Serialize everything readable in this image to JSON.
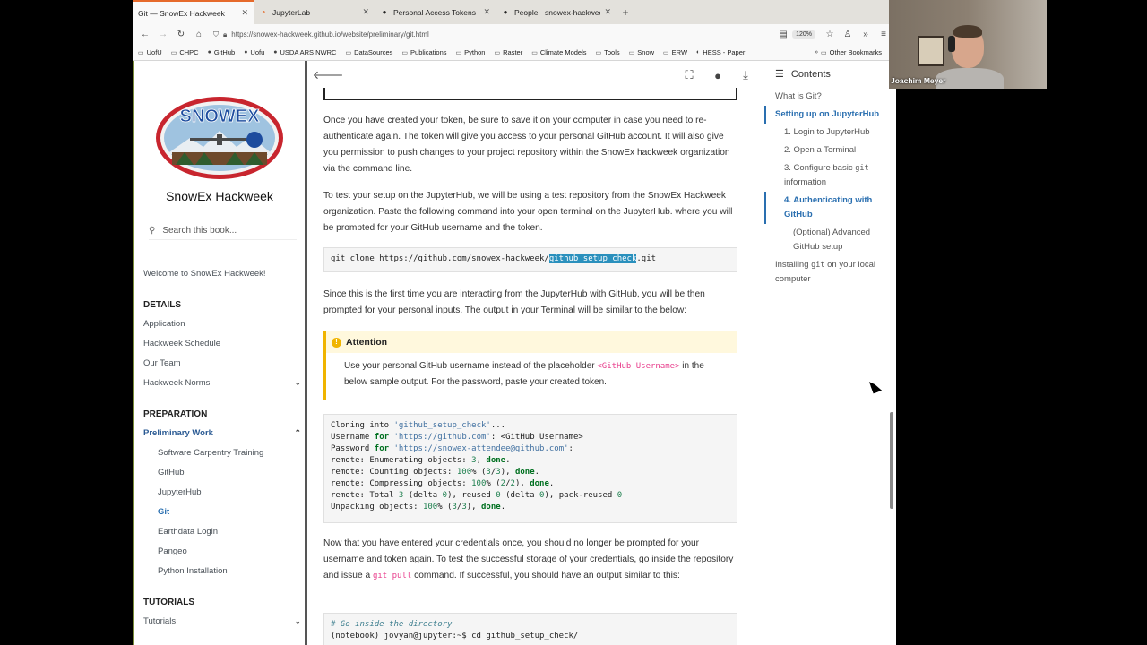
{
  "tabs": [
    {
      "title": "Git — SnowEx Hackweek",
      "icon": "git-icon",
      "active": true
    },
    {
      "title": "JupyterLab",
      "icon": "jupyter-icon",
      "active": false
    },
    {
      "title": "Personal Access Tokens",
      "icon": "github-icon",
      "active": false
    },
    {
      "title": "People · snowex-hackweek",
      "icon": "github-icon",
      "active": false
    }
  ],
  "address": {
    "url": "https://snowex-hackweek.github.io/website/preliminary/git.html",
    "zoom": "120%"
  },
  "bookmarks": [
    "UofU",
    "CHPC",
    "GitHub",
    "Uofu",
    "USDA ARS NWRC",
    "DataSources",
    "Publications",
    "Python",
    "Raster",
    "Climate Models",
    "Tools",
    "Snow",
    "ERW",
    "HESS - Paper"
  ],
  "bookmarks_other": "Other Bookmarks",
  "sidebar": {
    "title": "SnowEx Hackweek",
    "logo_text": "SNOWEX",
    "search_placeholder": "Search this book...",
    "welcome": "Welcome to SnowEx Hackweek!",
    "sections": [
      {
        "caption": "DETAILS",
        "items": [
          "Application",
          "Hackweek Schedule",
          "Our Team",
          "Hackweek Norms"
        ]
      },
      {
        "caption": "PREPARATION",
        "items": [
          "Preliminary Work"
        ]
      },
      {
        "caption": "TUTORIALS",
        "items": [
          "Tutorials"
        ]
      }
    ],
    "preliminary_sub": [
      "Software Carpentry Training",
      "GitHub",
      "JupyterHub",
      "Git",
      "Earthdata Login",
      "Pangeo",
      "Python Installation"
    ]
  },
  "content": {
    "p1": "Once you have created your token, be sure to save it on your computer in case you need to re-authenticate again. The token will give you access to your personal GitHub account. It will also give you permission to push changes to your project repository within the SnowEx hackweek organization via the command line.",
    "p2": "To test your setup on the JupyterHub, we will be using a test repository from the SnowEx Hackweek organization. Paste the following command into your open terminal on the JupyterHub. where you will be prompted for your GitHub username and the token.",
    "cmd_prefix": "git clone https://github.com/snowex-hackweek/",
    "cmd_highlight": "github_setup_check",
    "cmd_suffix": ".git",
    "p3": "Since this is the first time you are interacting from the JupyterHub with GitHub, you will be then prompted for your personal inputs. The output in your Terminal will be similar to the below:",
    "attention_title": "Attention",
    "attention_before": "Use your personal GitHub username instead of the placeholder ",
    "attention_code": "<GitHub Username>",
    "attention_after": " in the below sample output. For the password, paste your created token.",
    "p4_before": "Now that you have entered your credentials once, you should no longer be prompted for your username and token again. To test the successful storage of your credentials, go inside the repository and issue a ",
    "p4_code": "git pull",
    "p4_after": " command. If successful, you should have an output similar to this:",
    "comment": "# Go inside the directory",
    "cd_line": "(notebook) jovyan@jupyter:~$ cd github_setup_check/"
  },
  "toc": {
    "heading": "Contents",
    "items": [
      "What is Git?",
      "Setting up on JupyterHub",
      "1. Login to JupyterHub",
      "2. Open a Terminal",
      "4. Authenticating with GitHub",
      "(Optional) Advanced GitHub setup",
      "Installing"
    ],
    "item3_before": "3. Configure basic ",
    "item3_code": "git",
    "item3_after": " information",
    "last_code": "git",
    "last_after": " on your local computer"
  },
  "webcam": {
    "name": "Joachim Meyer"
  }
}
